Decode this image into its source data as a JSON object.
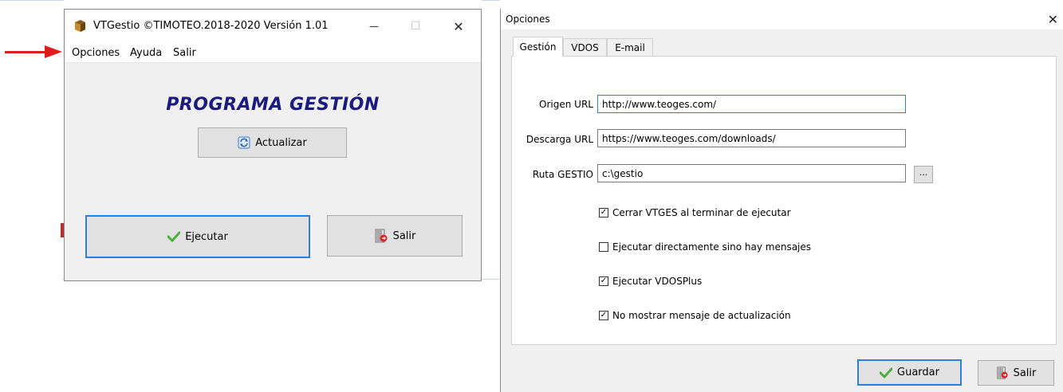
{
  "main_window": {
    "title": "VTGestio  ©TIMOTEO.2018-2020  Versión 1.01",
    "menu": [
      "Opciones",
      "Ayuda",
      "Salir"
    ],
    "heading": "PROGRAMA GESTIÓN",
    "update_label": "Actualizar",
    "run_label": "Ejecutar",
    "exit_label": "Salir",
    "minimize_glyph": "—",
    "maximize_glyph": "☐",
    "close_glyph": "✕"
  },
  "options_dialog": {
    "title": "Opciones",
    "close_glyph": "✕",
    "tabs": [
      "Gestión",
      "VDOS",
      "E-mail"
    ],
    "fields": {
      "origin_label": "Origen URL",
      "origin_value": "http://www.teoges.com/",
      "download_label": "Descarga URL",
      "download_value": "https://www.teoges.com/downloads/",
      "path_label": "Ruta GESTIO",
      "path_value": "c:\\gestio",
      "browse_label": "..."
    },
    "checkboxes": [
      {
        "label": "Cerrar VTGES al terminar de ejecutar",
        "checked": true
      },
      {
        "label": "Ejecutar directamente sino hay mensajes",
        "checked": false
      },
      {
        "label": "Ejecutar VDOSPlus",
        "checked": true
      },
      {
        "label": "No mostrar mensaje de actualización",
        "checked": true
      }
    ],
    "save_label": "Guardar",
    "exit_label": "Salir",
    "check_glyph": "✓"
  },
  "colors": {
    "annotation_arrow": "#e01b1b",
    "heading": "#1a1a80",
    "focus_border": "#2f7fd8"
  }
}
